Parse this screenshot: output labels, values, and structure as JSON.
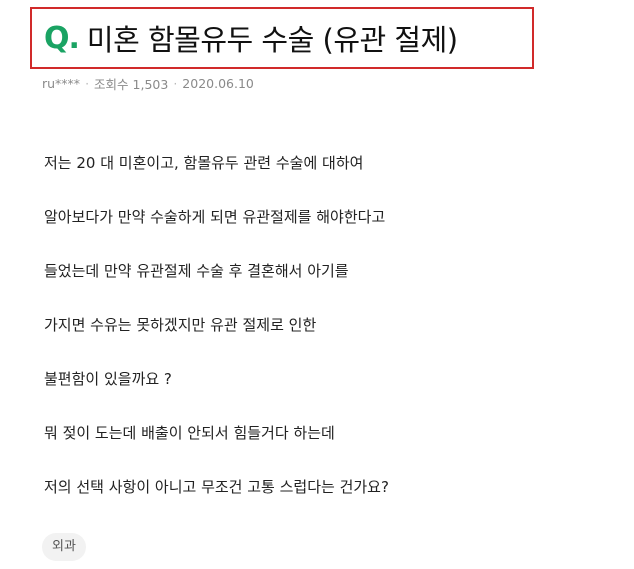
{
  "question": {
    "q_mark": "Q.",
    "title": "미혼 함몰유두 수술 (유관 절제)"
  },
  "meta": {
    "author": "ru****",
    "views": "조회수 1,503",
    "date": "2020.06.10",
    "separator": "·"
  },
  "body": {
    "paragraphs": [
      "저는 20 대 미혼이고, 함몰유두 관련 수술에 대하여",
      "알아보다가 만약 수술하게 되면 유관절제를 해야한다고",
      "들었는데 만약 유관절제 수술 후 결혼해서 아기를",
      "가지면 수유는 못하겠지만 유관 절제로 인한",
      "불편함이 있을까요 ?",
      "뭐 젖이 도는데 배출이 안되서 힘들거다 하는데",
      "저의 선택 사항이 아니고 무조건 고통 스럽다는 건가요?"
    ]
  },
  "tags": [
    "외과"
  ],
  "colors": {
    "highlight_border": "#d12a2a",
    "q_mark": "#1aa363",
    "meta_text": "#8a8a8a",
    "tag_bg": "#f2f2f2"
  }
}
